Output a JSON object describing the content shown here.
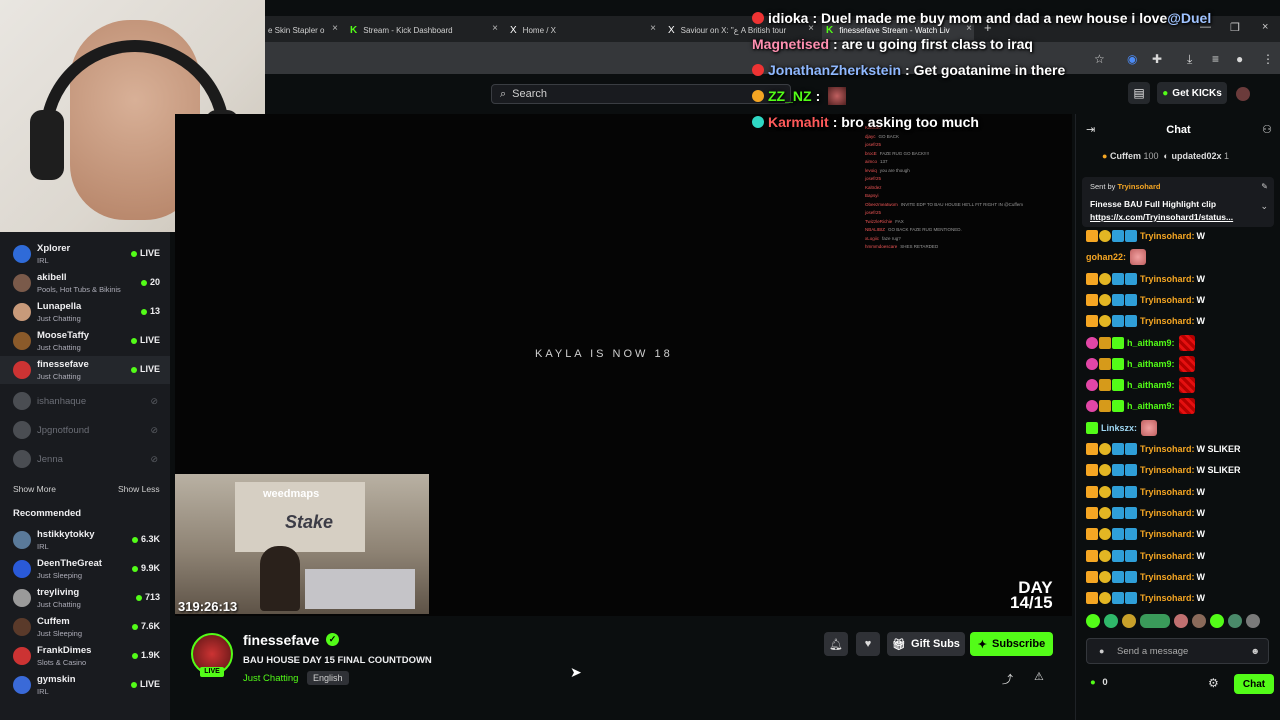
{
  "browser": {
    "tabs": [
      {
        "label": "e Skin Stapler o",
        "icon": ""
      },
      {
        "label": "Stream - Kick Dashboard",
        "icon": "K"
      },
      {
        "label": "Home / X",
        "icon": "X"
      },
      {
        "label": "Saviour on X: \"ع A British tour",
        "icon": "X"
      },
      {
        "label": "finessefave Stream - Watch Liv",
        "icon": "K"
      }
    ],
    "new_tab": "+",
    "close_glyph": "×"
  },
  "header": {
    "search_placeholder": "Search",
    "get_kicks": "Get KICKs"
  },
  "overlay_chat": [
    {
      "user": "idioka",
      "user_color": "#ffffff",
      "badge_color": "#e33",
      "text": "Duel made me buy mom and dad a new house i love ",
      "mention": "@Duel"
    },
    {
      "user": "Magnetised",
      "user_color": "#ff8fb0",
      "badge_color": "",
      "text": "are u going first class to iraq",
      "mention": ""
    },
    {
      "user": "JonathanZherkstein",
      "user_color": "#8fb8ff",
      "badge_color": "#e33",
      "text": "Get goatanime in there",
      "mention": ""
    },
    {
      "user": "ZZ_NZ",
      "user_color": "#53fc18",
      "badge_color": "#f5a623",
      "text": "",
      "mention": ""
    },
    {
      "user": "Karmahit",
      "user_color": "#ff5a5a",
      "badge_color": "#2fd8c4",
      "text": "bro asking too much",
      "mention": ""
    }
  ],
  "sidebar": {
    "following": [
      {
        "name": "Xplorer",
        "category": "IRL",
        "count": "LIVE",
        "avatar_color": "#2f6bd8"
      },
      {
        "name": "akibell",
        "category": "Pools, Hot Tubs & Bikinis",
        "count": "20",
        "avatar_color": "#7a5a4a"
      },
      {
        "name": "Lunapella",
        "category": "Just Chatting",
        "count": "13",
        "avatar_color": "#c89a7a"
      },
      {
        "name": "MooseTaffy",
        "category": "Just Chatting",
        "count": "LIVE",
        "avatar_color": "#8a5a2a"
      },
      {
        "name": "finessefave",
        "category": "Just Chatting",
        "count": "LIVE",
        "avatar_color": "#c33"
      }
    ],
    "offline": [
      "ishanhaque",
      "Jpgnotfound",
      "Jenna"
    ],
    "show_more": "Show More",
    "show_less": "Show Less",
    "recommended_title": "Recommended",
    "recommended": [
      {
        "name": "hstikkytokky",
        "category": "IRL",
        "count": "6.3K",
        "avatar_color": "#5a7a9a"
      },
      {
        "name": "DeenTheGreat",
        "category": "Just Sleeping",
        "count": "9.9K",
        "avatar_color": "#2a5ad8"
      },
      {
        "name": "treyliving",
        "category": "Just Chatting",
        "count": "713",
        "avatar_color": "#9a9a9a"
      },
      {
        "name": "Cuffem",
        "category": "Just Sleeping",
        "count": "7.6K",
        "avatar_color": "#5a3a2a"
      },
      {
        "name": "FrankDimes",
        "category": "Slots & Casino",
        "count": "1.9K",
        "avatar_color": "#c33"
      },
      {
        "name": "gymskin",
        "category": "IRL",
        "count": "LIVE",
        "avatar_color": "#3a6ad8"
      }
    ]
  },
  "video": {
    "title_card": "KAYLA IS NOW 18",
    "day_line1": "DAY",
    "day_line2": "14/15",
    "timer": "319:26:13",
    "pip_logo": "weedmaps",
    "pip_sign": "Stake",
    "overlay_lines": [
      {
        "name": "Kaltrdez",
        "text": ""
      },
      {
        "name": "djayc",
        "text": "GO BACK"
      },
      {
        "name": "josefr25",
        "text": ""
      },
      {
        "name": "brocE",
        "text": "FAZE RUG GO BACK!!!!"
      },
      {
        "name": "aimco",
        "text": "137"
      },
      {
        "name": "levoiq",
        "text": "you are though"
      },
      {
        "name": "josefr25",
        "text": ""
      },
      {
        "name": "Kaltrdez",
        "text": ""
      },
      {
        "name": "Bapsyi",
        "text": ""
      },
      {
        "name": "Obeezmeatwom",
        "text": "INVITE EDP TO BAU HOUSE HE'LL FIT RIGHT IN @Cuffem"
      },
      {
        "name": "josefr25",
        "text": ""
      },
      {
        "name": "TwizzleRichie",
        "text": "FAX"
      },
      {
        "name": "NBALIBIZ",
        "text": "GO BACK FAZE RUG MENTIONED."
      },
      {
        "name": "xLogiic",
        "text": "faze rug?"
      },
      {
        "name": "hmmmdoescare",
        "text": "SHES RETARDED"
      }
    ]
  },
  "stream": {
    "streamer": "finessefave",
    "live_badge": "LIVE",
    "verified_glyph": "✓",
    "title": "BAU HOUSE DAY 15 FINAL COUNTDOWN",
    "category": "Just Chatting",
    "language": "English",
    "gift_subs": "Gift Subs",
    "subscribe": "Subscribe"
  },
  "chat": {
    "title": "Chat",
    "gifters": [
      {
        "name": "Cuffem",
        "amount": "100"
      },
      {
        "name": "updated02x",
        "amount": "1"
      }
    ],
    "pinned": {
      "sent_by_label": "Sent by",
      "sent_by_user": "Tryinsohard",
      "message": "Finesse BAU Full Highlight clip",
      "link": "https://x.com/Tryinsohard1/status..."
    },
    "messages": [
      {
        "user": "Tryinsohard:",
        "color": "orange",
        "badges": [
          "crown",
          "coin",
          "blue",
          "blue"
        ],
        "text": "W",
        "emote": ""
      },
      {
        "user": "gohan22:",
        "color": "orange",
        "badges": [],
        "text": "",
        "emote": "face"
      },
      {
        "user": "Tryinsohard:",
        "color": "orange",
        "badges": [
          "crown",
          "coin",
          "blue",
          "blue"
        ],
        "text": "W",
        "emote": ""
      },
      {
        "user": "Tryinsohard:",
        "color": "orange",
        "badges": [
          "crown",
          "coin",
          "blue",
          "blue"
        ],
        "text": "W",
        "emote": ""
      },
      {
        "user": "Tryinsohard:",
        "color": "orange",
        "badges": [
          "crown",
          "coin",
          "blue",
          "blue"
        ],
        "text": "W",
        "emote": ""
      },
      {
        "user": "h_aitham9:",
        "color": "green",
        "badges": [
          "pink",
          "gold",
          "green"
        ],
        "text": "",
        "emote": "red"
      },
      {
        "user": "h_aitham9:",
        "color": "green",
        "badges": [
          "pink",
          "gold",
          "green"
        ],
        "text": "",
        "emote": "red"
      },
      {
        "user": "h_aitham9:",
        "color": "green",
        "badges": [
          "pink",
          "gold",
          "green"
        ],
        "text": "",
        "emote": "red"
      },
      {
        "user": "h_aitham9:",
        "color": "green",
        "badges": [
          "pink",
          "gold",
          "green"
        ],
        "text": "",
        "emote": "red"
      },
      {
        "user": "Linkszx:",
        "color": "lblue",
        "badges": [
          "green"
        ],
        "text": "",
        "emote": "face"
      },
      {
        "user": "Tryinsohard:",
        "color": "orange",
        "badges": [
          "crown",
          "coin",
          "blue",
          "blue"
        ],
        "text": "W SLIKER",
        "emote": ""
      },
      {
        "user": "Tryinsohard:",
        "color": "orange",
        "badges": [
          "crown",
          "coin",
          "blue",
          "blue"
        ],
        "text": "W SLIKER",
        "emote": ""
      },
      {
        "user": "Tryinsohard:",
        "color": "orange",
        "badges": [
          "crown",
          "coin",
          "blue",
          "blue"
        ],
        "text": "W",
        "emote": ""
      },
      {
        "user": "Tryinsohard:",
        "color": "orange",
        "badges": [
          "crown",
          "coin",
          "blue",
          "blue"
        ],
        "text": "W",
        "emote": ""
      },
      {
        "user": "Tryinsohard:",
        "color": "orange",
        "badges": [
          "crown",
          "coin",
          "blue",
          "blue"
        ],
        "text": "W",
        "emote": ""
      },
      {
        "user": "Tryinsohard:",
        "color": "orange",
        "badges": [
          "crown",
          "coin",
          "blue",
          "blue"
        ],
        "text": "W",
        "emote": ""
      },
      {
        "user": "Tryinsohard:",
        "color": "orange",
        "badges": [
          "crown",
          "coin",
          "blue",
          "blue"
        ],
        "text": "W",
        "emote": ""
      },
      {
        "user": "Tryinsohard:",
        "color": "orange",
        "badges": [
          "crown",
          "coin",
          "blue",
          "blue"
        ],
        "text": "W",
        "emote": ""
      }
    ],
    "input_placeholder": "Send a message",
    "kicks_count": "0",
    "chat_button": "Chat"
  },
  "icons": {
    "search": "search-icon",
    "bell": "bell-icon",
    "heart": "heart-icon",
    "gift": "gift-icon",
    "share": "share-icon",
    "report": "warning-icon",
    "gear": "gear-icon"
  }
}
